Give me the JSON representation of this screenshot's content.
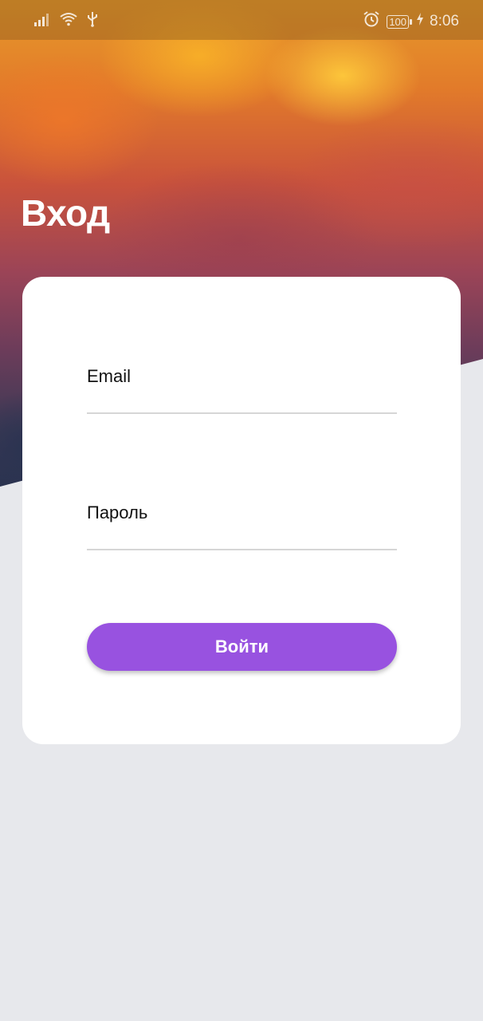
{
  "status_bar": {
    "time": "8:06",
    "battery": "100",
    "icons": [
      "signal-icon",
      "wifi-icon",
      "usb-icon",
      "alarm-icon",
      "battery-icon",
      "charging-icon"
    ]
  },
  "screen": {
    "title": "Вход"
  },
  "form": {
    "email_label": "Email",
    "password_label": "Пароль",
    "submit_label": "Войти"
  },
  "colors": {
    "accent": "#9852e0",
    "background": "#e7e8ec",
    "card": "#ffffff"
  }
}
